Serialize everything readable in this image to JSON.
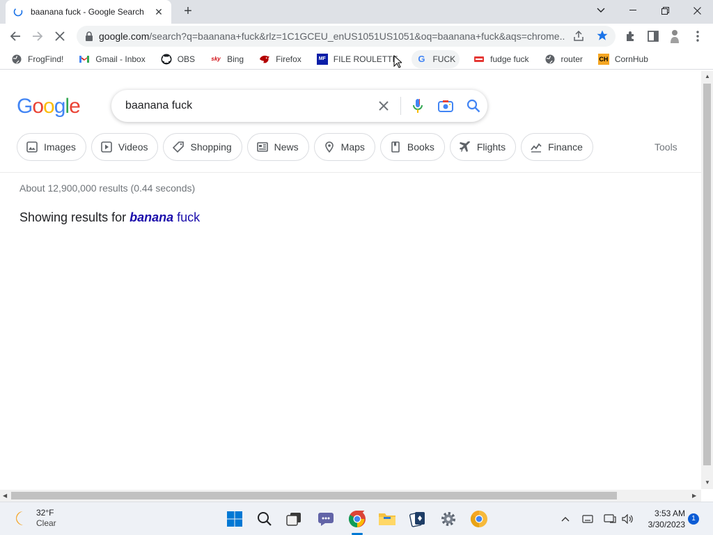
{
  "browser": {
    "tab": {
      "title": "baanana fuck - Google Search",
      "close": "✕"
    },
    "new_tab": "+",
    "address": {
      "url_host": "google.com",
      "url_rest": "/search?q=baanana+fuck&rlz=1C1GCEU_enUS1051US1051&oq=baanana+fuck&aqs=chrome...."
    },
    "bookmarks": [
      {
        "label": "FrogFind!",
        "icon": "globe-icon"
      },
      {
        "label": "Gmail - Inbox",
        "icon": "gmail-icon"
      },
      {
        "label": "OBS",
        "icon": "github-icon"
      },
      {
        "label": "Bing",
        "icon": "sky-icon"
      },
      {
        "label": "Firefox",
        "icon": "firefox-icon"
      },
      {
        "label": "FILE ROULETTE",
        "icon": "mf-icon"
      },
      {
        "label": "FUCK",
        "icon": "google-icon"
      },
      {
        "label": "fudge fuck",
        "icon": "fudge-icon"
      },
      {
        "label": "router",
        "icon": "globe-icon"
      },
      {
        "label": "CornHub",
        "icon": "ch-icon"
      }
    ]
  },
  "google": {
    "logo": [
      "G",
      "o",
      "o",
      "g",
      "l",
      "e"
    ],
    "logo_colors": [
      "#4285f4",
      "#ea4335",
      "#fbbc05",
      "#4285f4",
      "#34a853",
      "#ea4335"
    ],
    "query": "baanana fuck",
    "chips": [
      {
        "label": "Images",
        "icon": "image-icon"
      },
      {
        "label": "Videos",
        "icon": "video-icon"
      },
      {
        "label": "Shopping",
        "icon": "tag-icon"
      },
      {
        "label": "News",
        "icon": "news-icon"
      },
      {
        "label": "Maps",
        "icon": "map-pin-icon"
      },
      {
        "label": "Books",
        "icon": "book-icon"
      },
      {
        "label": "Flights",
        "icon": "plane-icon"
      },
      {
        "label": "Finance",
        "icon": "finance-icon"
      }
    ],
    "tools": "Tools",
    "stats": "About 12,900,000 results (0.44 seconds)",
    "showing_prefix": "Showing results for",
    "corrected_bold": "banana",
    "corrected_rest": "fuck"
  },
  "taskbar": {
    "weather_temp": "32°F",
    "weather_cond": "Clear",
    "time": "3:53 AM",
    "date": "3/30/2023",
    "notifications": "1"
  }
}
